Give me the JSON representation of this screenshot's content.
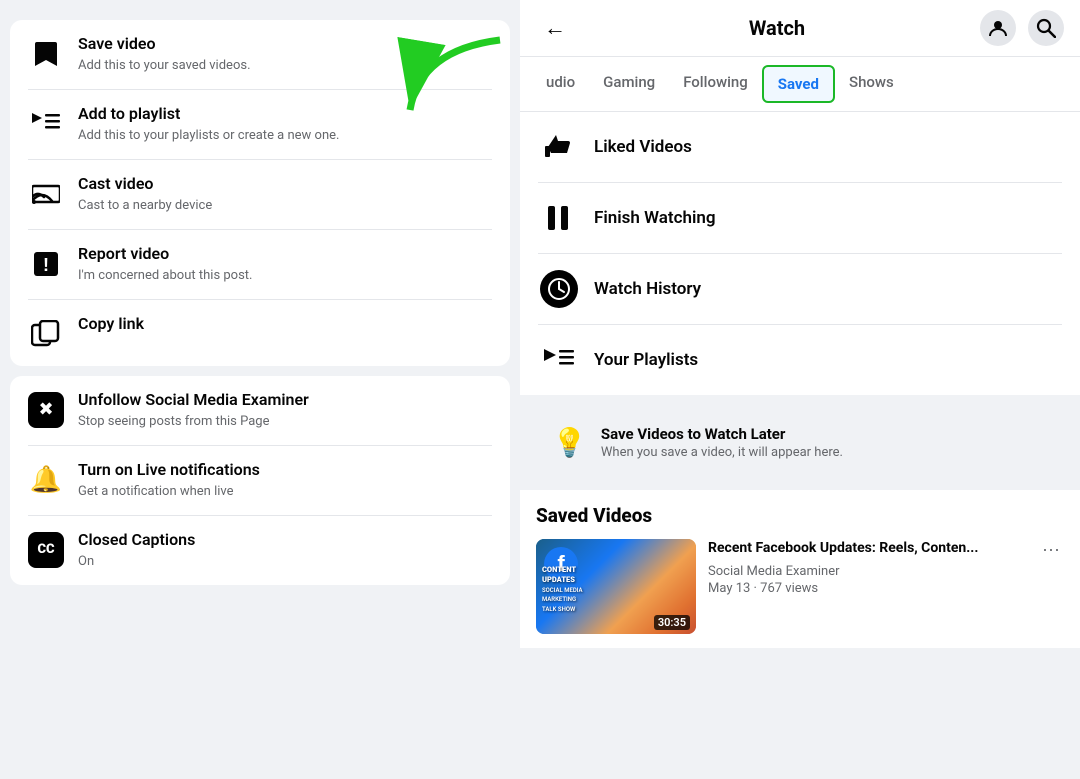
{
  "left": {
    "menu_card_1": {
      "items": [
        {
          "id": "save-video",
          "icon": "🔖",
          "icon_type": "plain",
          "title": "Save video",
          "subtitle": "Add this to your saved videos."
        },
        {
          "id": "add-to-playlist",
          "icon": "▶≡",
          "icon_type": "plain",
          "title": "Add to playlist",
          "subtitle": "Add this to your playlists or create a new one."
        },
        {
          "id": "cast-video",
          "icon": "📡",
          "icon_type": "plain",
          "title": "Cast video",
          "subtitle": "Cast to a nearby device"
        },
        {
          "id": "report-video",
          "icon": "❗",
          "icon_type": "plain",
          "title": "Report video",
          "subtitle": "I'm concerned about this post."
        },
        {
          "id": "copy-link",
          "icon": "🔗",
          "icon_type": "plain",
          "title": "Copy link",
          "subtitle": ""
        }
      ]
    },
    "menu_card_2": {
      "items": [
        {
          "id": "unfollow",
          "icon": "✖",
          "icon_type": "square",
          "title": "Unfollow Social Media Examiner",
          "subtitle": "Stop seeing posts from this Page"
        },
        {
          "id": "live-notifications",
          "icon": "🔔",
          "icon_type": "plain",
          "title": "Turn on Live notifications",
          "subtitle": "Get a notification when live"
        },
        {
          "id": "closed-captions",
          "icon": "CC",
          "icon_type": "square",
          "title": "Closed Captions",
          "subtitle": "On"
        }
      ]
    }
  },
  "right": {
    "header": {
      "title": "Watch",
      "back_label": "←",
      "profile_icon": "👤",
      "search_icon": "🔍"
    },
    "tabs": [
      {
        "id": "audio",
        "label": "udio",
        "active": false
      },
      {
        "id": "gaming",
        "label": "Gaming",
        "active": false
      },
      {
        "id": "following",
        "label": "Following",
        "active": false
      },
      {
        "id": "saved",
        "label": "Saved",
        "active": true
      },
      {
        "id": "shows",
        "label": "Shows",
        "active": false
      }
    ],
    "saved_menu": [
      {
        "id": "liked-videos",
        "icon": "👍",
        "icon_type": "plain",
        "label": "Liked Videos"
      },
      {
        "id": "finish-watching",
        "icon": "⏸",
        "icon_type": "plain",
        "label": "Finish Watching"
      },
      {
        "id": "watch-history",
        "icon": "🕐",
        "icon_type": "circle",
        "label": "Watch History"
      },
      {
        "id": "your-playlists",
        "icon": "▶≡",
        "icon_type": "plain",
        "label": "Your Playlists"
      }
    ],
    "save_later": {
      "icon": "💡",
      "title": "Save Videos to Watch Later",
      "subtitle": "When you save a video, it will appear here."
    },
    "saved_videos": {
      "section_title": "Saved Videos",
      "items": [
        {
          "id": "video-1",
          "title": "Recent Facebook Updates: Reels, Conten...",
          "channel": "Social Media Examiner",
          "meta": "May 13 · 767 views",
          "duration": "30:35",
          "thumb_text": "CONTENT\nUPDATES"
        }
      ]
    }
  }
}
